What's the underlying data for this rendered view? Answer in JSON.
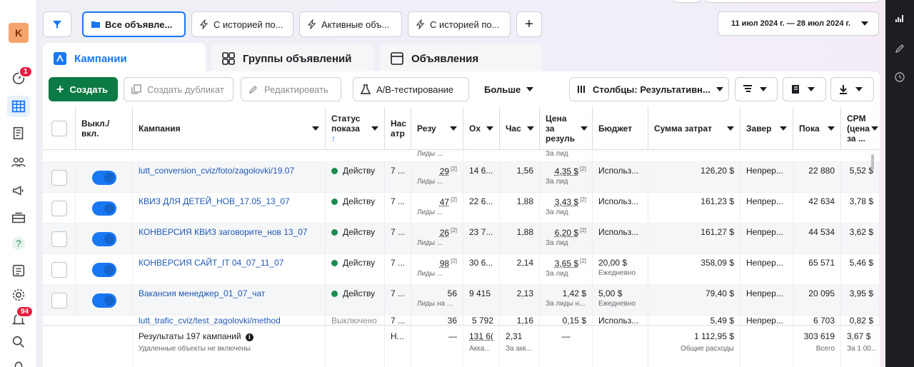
{
  "account": {
    "avatar_letter": "K"
  },
  "rail": {
    "notifications_badge": "1",
    "alerts_badge": "94"
  },
  "filters": [
    {
      "label": "Все объявле...",
      "icon": "folder-icon",
      "active": true
    },
    {
      "label": "С историей по...",
      "icon": "bolt-icon",
      "active": false
    },
    {
      "label": "Активные объ...",
      "icon": "bolt-icon",
      "active": false
    },
    {
      "label": "С историей по...",
      "icon": "bolt-icon",
      "active": false
    }
  ],
  "date_range": "11 июл 2024 г. — 28 июл 2024 г.",
  "tabs": [
    {
      "label": "Кампании",
      "icon": "campaign-icon"
    },
    {
      "label": "Группы объявлений",
      "icon": "grid-icon"
    },
    {
      "label": "Объявления",
      "icon": "ad-icon"
    }
  ],
  "toolbar": {
    "create": "Создать",
    "duplicate": "Создать дубликат",
    "edit": "Редактировать",
    "ab_test": "A/B-тестирование",
    "more": "Больше",
    "columns": "Столбцы: Результативн..."
  },
  "columns": {
    "onoff": "Выкл./ вкл.",
    "campaign": "Кампания",
    "status": "Статус показа",
    "attr": "Нас атр",
    "results": "Резу",
    "reach": "Ох",
    "freq": "Час",
    "cost": "Цена за резуль",
    "budget": "Бюджет",
    "spent": "Сумма затрат",
    "ends": "Завер",
    "impr": "Пока",
    "cpm": "CPM (цена за ..."
  },
  "partial_top_row": {
    "results_sub": "Лиды ...",
    "cost_sub": "За лид"
  },
  "rows": [
    {
      "name": "lutt_conversion_cviz/foto/zagolovki/19.07",
      "status": "Действу",
      "attr": "7 ...",
      "results": "29",
      "results_sub": "Лиды ...",
      "reach": "14 6...",
      "freq": "1,56",
      "cost": "4,35 $",
      "cost_sub": "За лид",
      "budget": "Использ...",
      "budget_sub": "",
      "spent": "126,20 $",
      "ends": "Непрер...",
      "impr": "22 880",
      "cpm": "5,52 $"
    },
    {
      "name": "КВИЗ ДЛЯ ДЕТЕЙ_НОВ_17.05_13_07",
      "status": "Действу",
      "attr": "7 ...",
      "results": "47",
      "results_sub": "Лиды ...",
      "reach": "22 6...",
      "freq": "1,88",
      "cost": "3,43 $",
      "cost_sub": "За лид",
      "budget": "Использ...",
      "budget_sub": "",
      "spent": "161,23 $",
      "ends": "Непрер...",
      "impr": "42 634",
      "cpm": "3,78 $"
    },
    {
      "name": "КОНВЕРСИЯ КВИЗ заговорите_нов 13_07",
      "status": "Действу",
      "attr": "7 ...",
      "results": "26",
      "results_sub": "Лиды ...",
      "reach": "23 7...",
      "freq": "1,88",
      "cost": "6,20 $",
      "cost_sub": "За лид",
      "budget": "Использ...",
      "budget_sub": "",
      "spent": "161,27 $",
      "ends": "Непрер...",
      "impr": "44 534",
      "cpm": "3,62 $"
    },
    {
      "name": "КОНВЕРСИЯ САЙТ_IT 04_07_11_07",
      "status": "Действу",
      "attr": "7 ...",
      "results": "98",
      "results_sub": "Лиды ...",
      "reach": "30 6...",
      "freq": "2,14",
      "cost": "3,65 $",
      "cost_sub": "За лид",
      "budget": "20,00 $",
      "budget_sub": "Ежедневно",
      "spent": "358,09 $",
      "ends": "Непрер...",
      "impr": "65 571",
      "cpm": "5,46 $"
    },
    {
      "name": "Вакансия менеджер_01_07_чат",
      "status": "Действу",
      "attr": "7 ...",
      "results": "56",
      "results_sub": "Лиды на ...",
      "reach": "9 415",
      "freq": "2,13",
      "cost": "1,42 $",
      "cost_sub": "За лиды н...",
      "budget": "5,00 $",
      "budget_sub": "Ежедневно",
      "spent": "79,40 $",
      "ends": "Непрер...",
      "impr": "20 095",
      "cpm": "3,95 $"
    }
  ],
  "partial_bottom_row": {
    "name": "lutt_trafic_cviz/test_zagolovki/method",
    "status": "Выключено",
    "attr": "7 ...",
    "results": "36",
    "reach": "5 792",
    "freq": "1,16",
    "cost": "0,15 $",
    "budget": "Использ...",
    "spent": "5,49 $",
    "ends": "Непрер...",
    "impr": "6 703",
    "cpm": "0,82 $"
  },
  "footer": {
    "title": "Результаты 197 кампаний",
    "subtitle": "Удаленные объекты не включены",
    "attr": "Н...",
    "results": "—",
    "reach": "131 6(",
    "reach_sub": "Акка...",
    "freq": "2,31",
    "freq_sub": "За акк...",
    "cost": "—",
    "spent": "1 112,95 $",
    "spent_sub": "Общие расходы",
    "impr": "303 619",
    "impr_sub": "Всего",
    "cpm": "3,67 $",
    "cpm_sub": "За 1 00..."
  }
}
